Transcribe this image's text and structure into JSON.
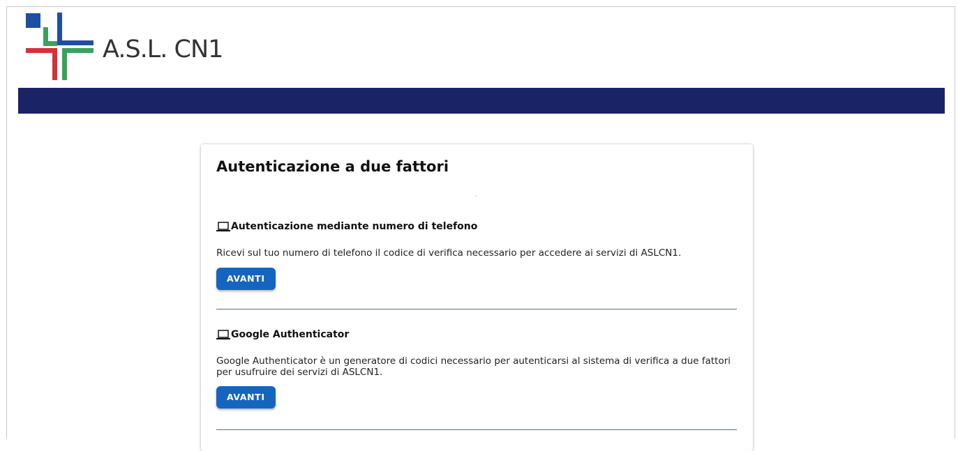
{
  "brand": {
    "logo_text": "A.S.L. CN1",
    "colors": {
      "navbar": "#1a2366",
      "button": "#1565c0",
      "logo_blue": "#1f4fa3",
      "logo_red": "#d7303a",
      "logo_green": "#3aa25c"
    }
  },
  "card": {
    "title": "Autenticazione a due fattori",
    "methods": [
      {
        "icon": "laptop-icon",
        "title": "Autenticazione mediante numero di telefono",
        "description": "Ricevi sul tuo numero di telefono il codice di verifica necessario per accedere ai servizi di ASLCN1.",
        "button_label": "AVANTI"
      },
      {
        "icon": "laptop-icon",
        "title": "Google Authenticator",
        "description": "Google Authenticator è un generatore di codici necessario per autenticarsi al sistema di verifica a due fattori per usufruire dei servizi di ASLCN1.",
        "button_label": "AVANTI"
      }
    ]
  }
}
